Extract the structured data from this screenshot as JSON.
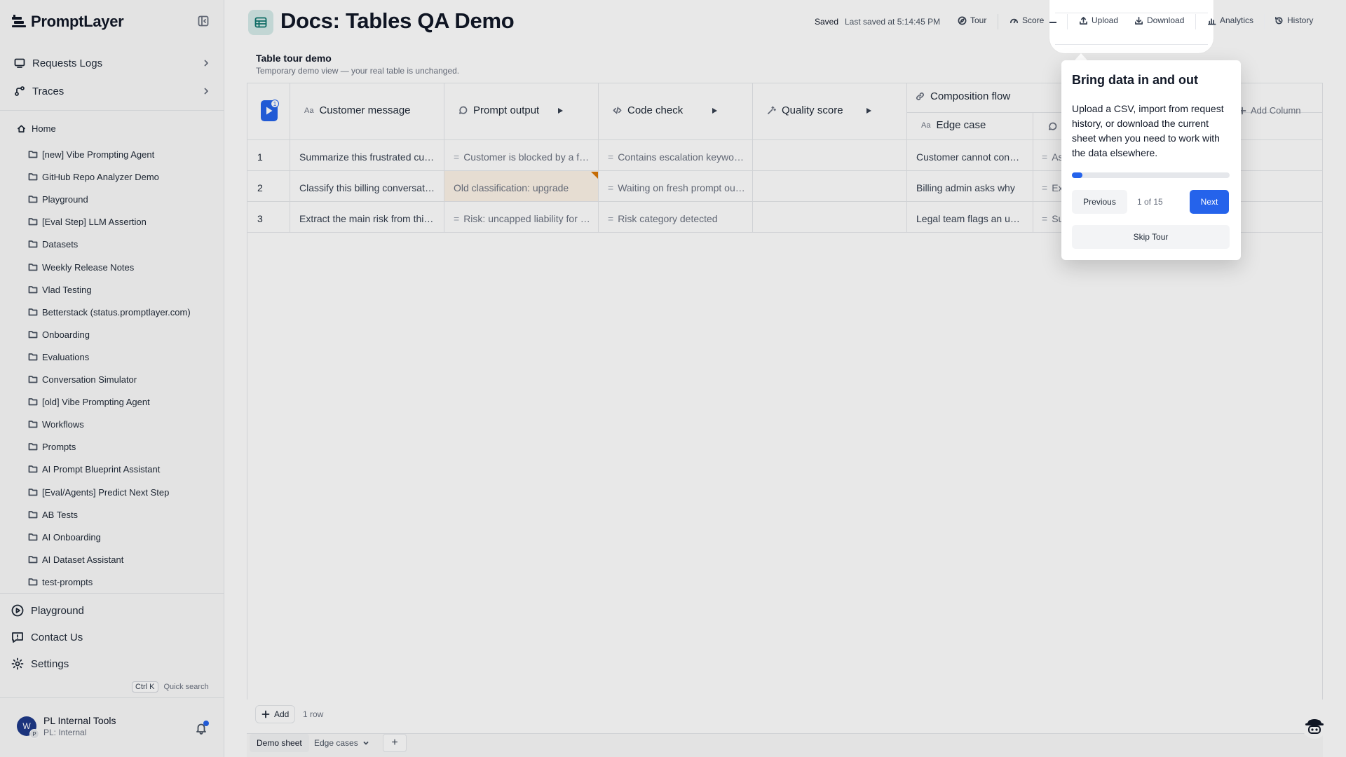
{
  "sidebar": {
    "logo": "PromptLayer",
    "requests_logs": "Requests Logs",
    "traces": "Traces",
    "home": "Home",
    "folders": [
      "[new] Vibe Prompting Agent",
      "GitHub Repo Analyzer Demo",
      "Playground",
      "[Eval Step] LLM Assertion",
      "Datasets",
      "Weekly Release Notes",
      "Vlad Testing",
      "Betterstack (status.promptlayer.com)",
      "Onboarding",
      "Evaluations",
      "Conversation Simulator",
      "[old] Vibe Prompting Agent",
      "Workflows",
      "Prompts",
      "AI Prompt Blueprint Assistant",
      "[Eval/Agents] Predict Next Step",
      "AB Tests",
      "AI Onboarding",
      "AI Dataset Assistant",
      "test-prompts"
    ],
    "playground": "Playground",
    "contact": "Contact Us",
    "settings": "Settings",
    "quick_search_key": "Ctrl K",
    "quick_search": "Quick search",
    "user_name": "PL Internal Tools",
    "user_org": "PL: Internal",
    "avatar_initial": "W",
    "avatar_sub": "P"
  },
  "header": {
    "title": "Docs: Tables QA Demo",
    "saved": "Saved",
    "last_saved": "Last saved at 5:14:45 PM",
    "toolbar": {
      "tour": "Tour",
      "score": "Score",
      "upload": "Upload",
      "download": "Download",
      "analytics": "Analytics",
      "history": "History"
    }
  },
  "table": {
    "banner_title": "Table tour demo",
    "banner_sub": "Temporary demo view — your real table is unchanged.",
    "run_badge": "1",
    "group_header": "Composition flow",
    "add_column": "Add Column",
    "columns": {
      "customer_message": "Customer message",
      "prompt_output": "Prompt output",
      "code_check": "Code check",
      "quality_score": "Quality score",
      "edge_case": "Edge case"
    },
    "rows": [
      {
        "num": "1",
        "message": "Summarize this frustrated customer email",
        "output": "Customer is blocked by a failed payment",
        "code": "Contains escalation keywords",
        "quality": "",
        "edge": "Customer cannot continue",
        "extra": "As"
      },
      {
        "num": "2",
        "message": "Classify this billing conversation",
        "output": "Old classification: upgrade",
        "code": "Waiting on fresh prompt output",
        "quality": "",
        "edge": "Billing admin asks why",
        "extra": "Ex"
      },
      {
        "num": "3",
        "message": "Extract the main risk from this contract",
        "output": "Risk: uncapped liability for vendor",
        "code": "Risk category detected",
        "quality": "",
        "edge": "Legal team flags an unusual clause",
        "extra": "Su"
      }
    ],
    "add_label": "Add",
    "row_count": "1 row"
  },
  "sheets": {
    "active": "Demo sheet",
    "other": "Edge cases",
    "add": "+"
  },
  "tour": {
    "title": "Bring data in and out",
    "body": "Upload a CSV, import from request history, or download the current sheet when you need to work with the data elsewhere.",
    "progress": 0.0667,
    "step": "1 of 15",
    "previous": "Previous",
    "next": "Next",
    "skip": "Skip Tour"
  },
  "colors": {
    "accent": "#2563eb",
    "stale_cell": "#fdf3e7",
    "stale_marker": "#d97706"
  }
}
